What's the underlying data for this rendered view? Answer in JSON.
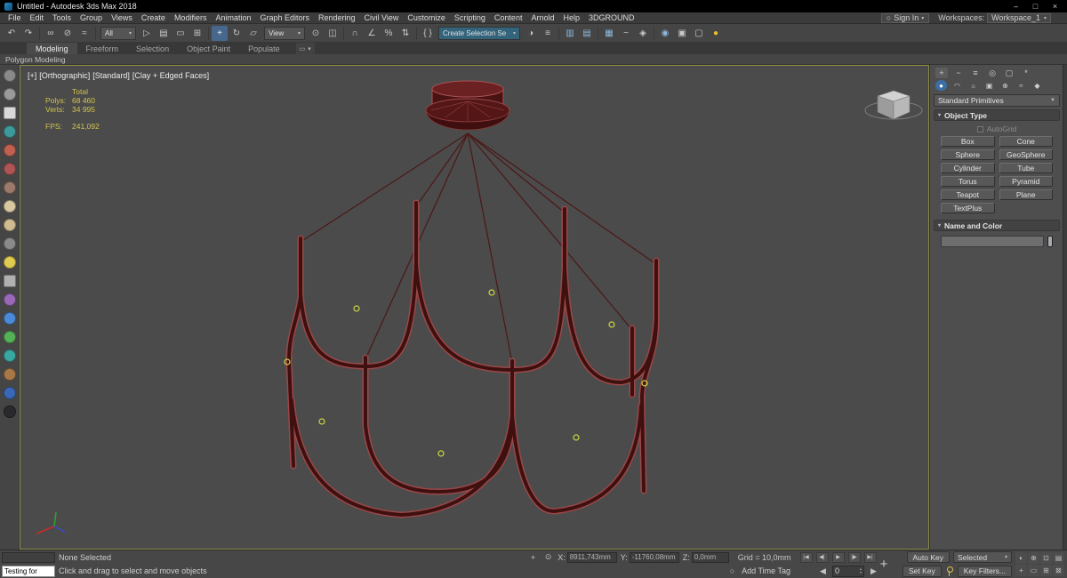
{
  "colors": {
    "stats_text": "#d2c44c",
    "wire_outer": "#9a4848",
    "wire_inner": "#3f1010",
    "marker_green": "#ccd83f",
    "selection_blue": "#47688c",
    "render_yellow": "#e8c030"
  },
  "glyphs": {
    "tiny_down": "▾",
    "down": "▼",
    "user": "○",
    "rollout": "▾",
    "ribbon_min_a": "▭",
    "ribbon_min_b": "▾",
    "typein_icon": "+",
    "offset_icon": "⊙",
    "clock_icon": "○",
    "spin_up": "▴",
    "spin_down": "▾",
    "frame_prev": "◀",
    "frame_next": "▶"
  },
  "titlebar": {
    "title": "Untitled - Autodesk 3ds Max 2018",
    "minimize": "–",
    "maximize": "□",
    "close": "×"
  },
  "menubar": {
    "items": [
      "File",
      "Edit",
      "Tools",
      "Group",
      "Views",
      "Create",
      "Modifiers",
      "Animation",
      "Graph Editors",
      "Rendering",
      "Civil View",
      "Customize",
      "Scripting",
      "Content",
      "Arnold",
      "Help",
      "3DGROUND"
    ]
  },
  "account": {
    "sign_in": "Sign In",
    "workspaces_label": "Workspaces:",
    "workspace": "Workspace_1"
  },
  "toolbar": {
    "filter_value": "All",
    "coord_value": "View",
    "named_sel_value": "Create Selection Se",
    "icons": [
      "↶",
      "↷",
      "∞",
      "⊘",
      "≈",
      "▷",
      "▤",
      "▭",
      "⊞",
      "+",
      "↻",
      "▱",
      "⊙",
      "◫",
      "∩",
      "∠",
      "%",
      "⇅",
      "{ }",
      "◑",
      "≡",
      "▥",
      "▤",
      "▦",
      "~",
      "◈",
      "◉",
      "▣",
      "▢",
      "●"
    ]
  },
  "ribbon": {
    "tabs": [
      "Modeling",
      "Freeform",
      "Selection",
      "Object Paint",
      "Populate"
    ],
    "subtab": "Polygon Modeling"
  },
  "left_toolbar": {
    "colors": [
      "#8a8a8a",
      "#9a9a9a",
      "#d8d8d8",
      "#3e9a9a",
      "#c06050",
      "#b05555",
      "#9a7a6a",
      "#d8c8a0",
      "#d0bc90",
      "#8a8a8a",
      "#e0cc50",
      "#b0b0b0",
      "#9a68b8",
      "#4a8ad8",
      "#56b056",
      "#38a8a0",
      "#a87848",
      "#3a68b8",
      "#2a2a2e"
    ]
  },
  "viewport": {
    "label_segments": [
      "[+]",
      "[Orthographic]",
      "[Standard]",
      "[Clay + Edged Faces]"
    ],
    "stats": {
      "total_label": "Total",
      "polys_label": "Polys:",
      "polys_value": "68 460",
      "verts_label": "Verts:",
      "verts_value": "34 995",
      "fps_label": "FPS:",
      "fps_value": "241,092"
    }
  },
  "command_panel": {
    "tab_icons": [
      "+",
      "~",
      "≡",
      "◎",
      "▢",
      "*"
    ],
    "cat_icons": [
      "●",
      "◠",
      "☼",
      "▣",
      "⊕",
      "≈",
      "◆"
    ],
    "category_dropdown": "Standard Primitives",
    "object_type_title": "Object Type",
    "autogrid_label": "AutoGrid",
    "primitive_buttons": [
      "Box",
      "Cone",
      "Sphere",
      "GeoSphere",
      "Cylinder",
      "Tube",
      "Torus",
      "Pyramid",
      "Teapot",
      "Plane",
      "TextPlus"
    ],
    "name_color_title": "Name and Color"
  },
  "statusbar": {
    "listener_text": "Testing for",
    "selection": "None Selected",
    "prompt": "Click and drag to select and move objects",
    "coords": {
      "x_label": "X:",
      "x": "8911,743mm",
      "y_label": "Y:",
      "y": "-11760,08mm",
      "z_label": "Z:",
      "z": "0,0mm"
    },
    "grid": "Grid = 10,0mm",
    "add_time_tag": "Add Time Tag",
    "transport": [
      "|◀",
      "◀|",
      "▶",
      "|▶",
      "▶|"
    ],
    "frame": "0",
    "auto_key": "Auto Key",
    "set_key": "Set Key",
    "selected_set": "Selected",
    "key_filters": "Key Filters...",
    "nav_icons_row1": [
      "◐",
      "⊕",
      "⊡",
      "▤"
    ],
    "nav_icons_row2": [
      "+",
      "▭",
      "⊞",
      "⊠"
    ]
  }
}
